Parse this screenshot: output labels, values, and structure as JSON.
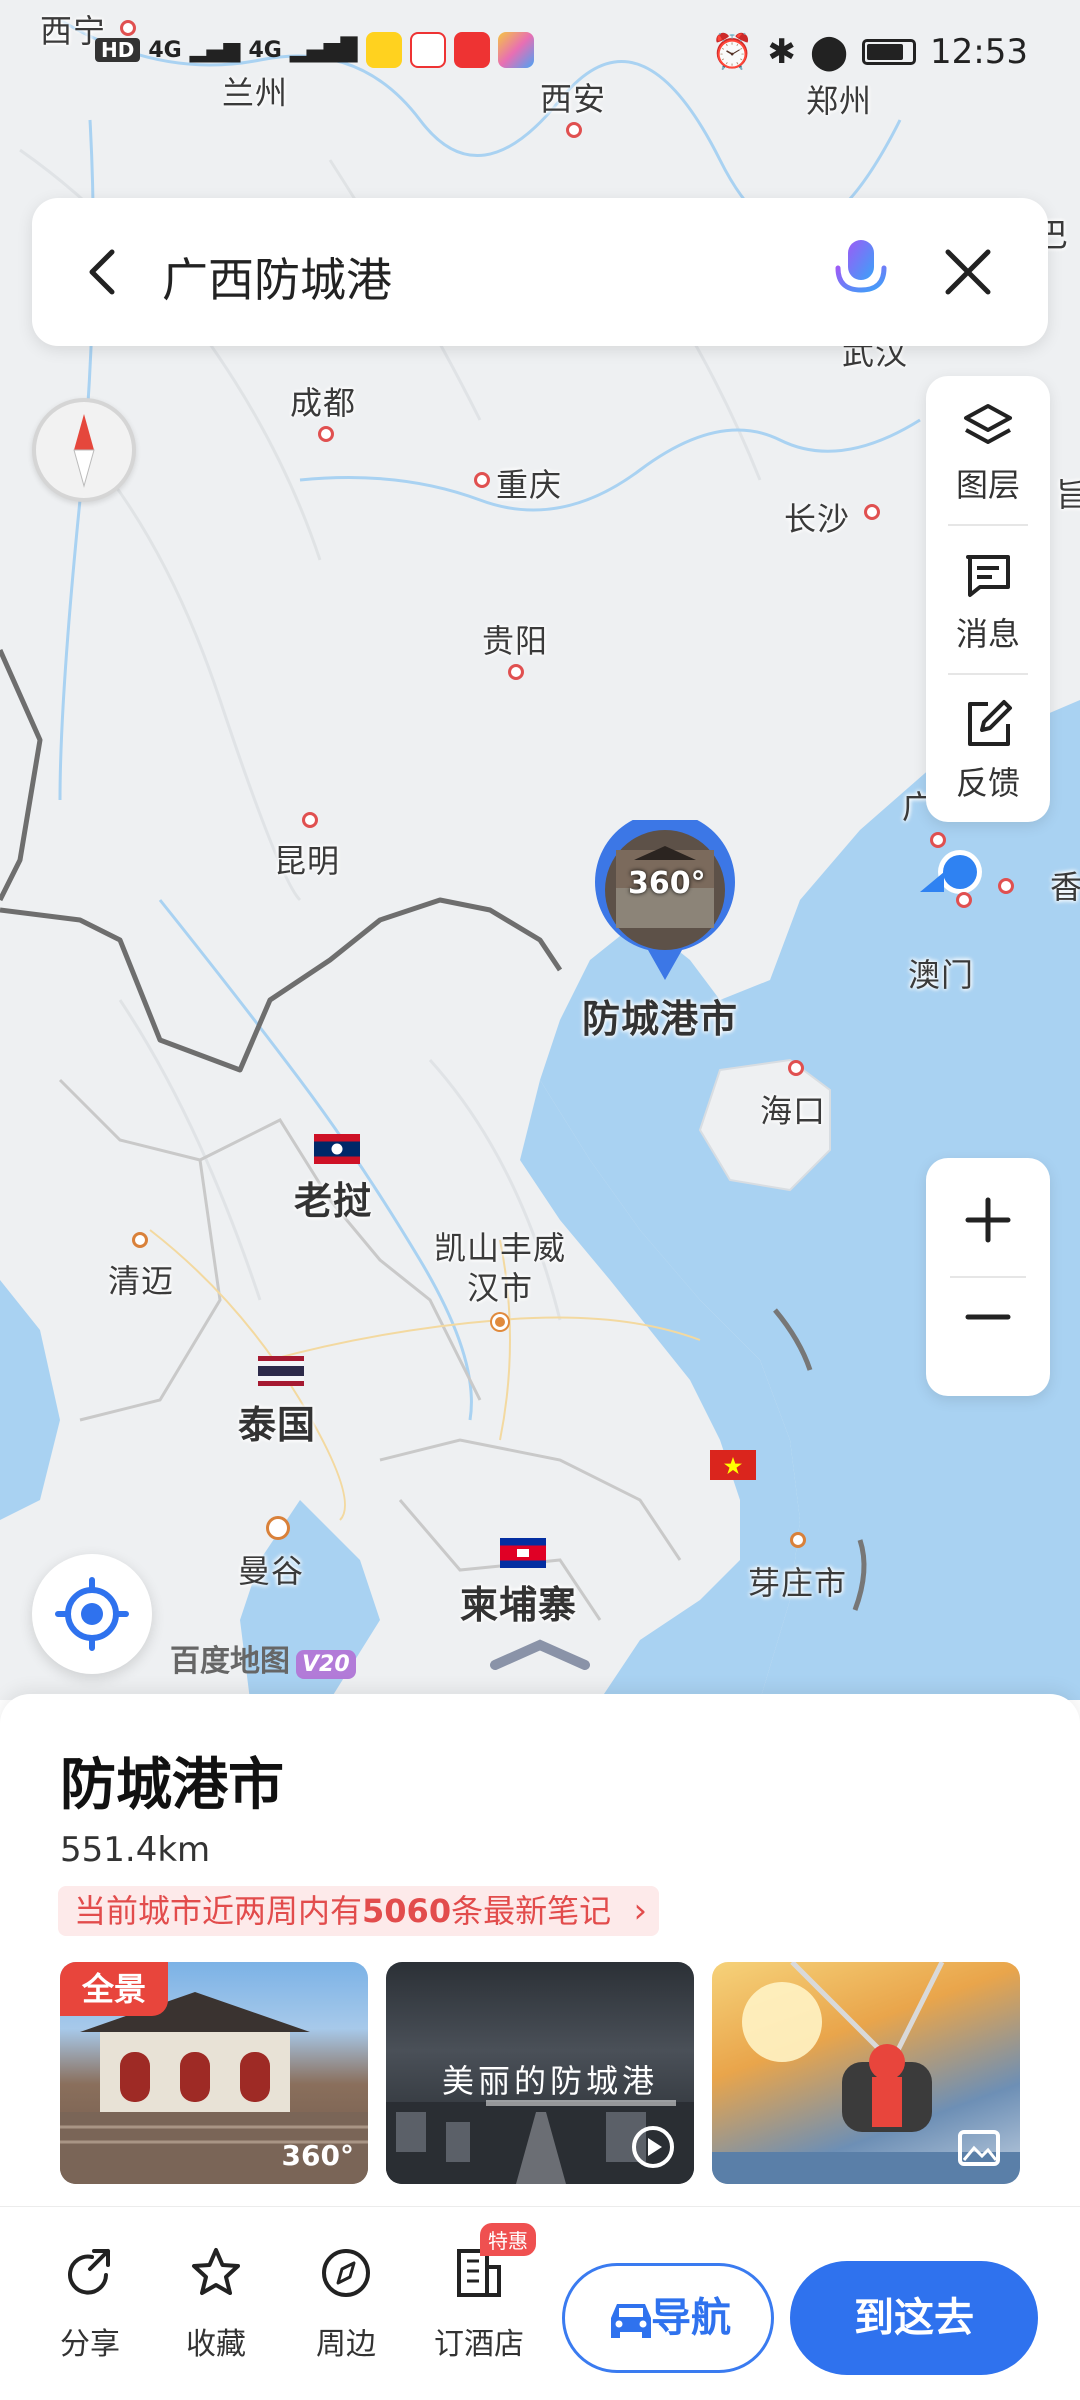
{
  "status_bar": {
    "time": "12:53",
    "network_badge": "HD",
    "signal_1": "4G",
    "signal_2": "4G",
    "app_icons": [
      "meituan-icon",
      "weibo-icon",
      "voice-recorder-icon",
      "notes-icon"
    ]
  },
  "search": {
    "query": "广西防城港"
  },
  "map_tools": [
    {
      "label": "图层",
      "icon": "layers-icon"
    },
    {
      "label": "消息",
      "icon": "message-icon"
    },
    {
      "label": "反馈",
      "icon": "feedback-icon"
    }
  ],
  "map": {
    "logo_text": "百度地图",
    "logo_version": "V20",
    "pano_badge": "360°",
    "places": {
      "xining": "西宁",
      "lanzhou": "兰州",
      "xian": "西安",
      "zhengzhou": "郑州",
      "chengdu": "成都",
      "chongqing": "重庆",
      "changsha": "长沙",
      "guiyang": "贵阳",
      "kunming": "昆明",
      "fangchenggang": "防城港市",
      "macau": "澳门",
      "haikou": "海口",
      "laos": "老挝",
      "chiangmai": "清迈",
      "kaysone": "凯山丰威\n汉市",
      "thailand": "泰国",
      "bangkok": "曼谷",
      "cambodia": "柬埔寨",
      "nhatrang": "芽庄市",
      "edge_wuhan": "武汉",
      "edge_ba": "巴",
      "edge_guang": "广",
      "edge_xiang": "香",
      "edge_e": "旨"
    }
  },
  "place_card": {
    "name": "防城港市",
    "distance": "551.4km",
    "notes_prefix": "当前城市近两周内有",
    "notes_count": "5060",
    "notes_suffix": "条最新笔记",
    "pano_tag": "全景",
    "pano_label": "360°",
    "video_caption": "美丽的防城港"
  },
  "actions": {
    "share": "分享",
    "favorite": "收藏",
    "nearby": "周边",
    "hotel": "订酒店",
    "hotel_badge": "特惠",
    "navigate": "导航",
    "go_here": "到这去"
  },
  "colors": {
    "primary_blue": "#2f72ee",
    "banner_red": "#e24c4c",
    "sea": "#a9d2f2",
    "land": "#eef0f2"
  }
}
